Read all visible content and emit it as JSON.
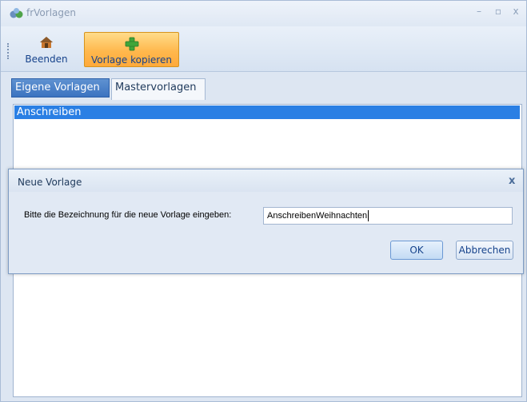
{
  "window": {
    "title": "frVorlagen"
  },
  "toolbar": {
    "beenden_label": "Beenden",
    "kopieren_label": "Vorlage kopieren"
  },
  "tabs": [
    {
      "label": "Eigene Vorlagen",
      "active": true
    },
    {
      "label": "Mastervorlagen",
      "active": false
    }
  ],
  "list": {
    "items": [
      "Anschreiben"
    ]
  },
  "dialog": {
    "title": "Neue Vorlage",
    "close": "x",
    "prompt": "Bitte die Bezeichnung für die neue Vorlage eingeben:",
    "input_value": "AnschreibenWeihnachten",
    "ok_label": "OK",
    "cancel_label": "Abbrechen"
  },
  "colors": {
    "accent": "#2a7fe4",
    "toolbar_active": "#ffb84d",
    "background": "#dde6f2"
  },
  "icons": [
    "app-icon",
    "house-icon",
    "plus-icon",
    "minimize-icon",
    "maximize-icon",
    "close-icon"
  ]
}
